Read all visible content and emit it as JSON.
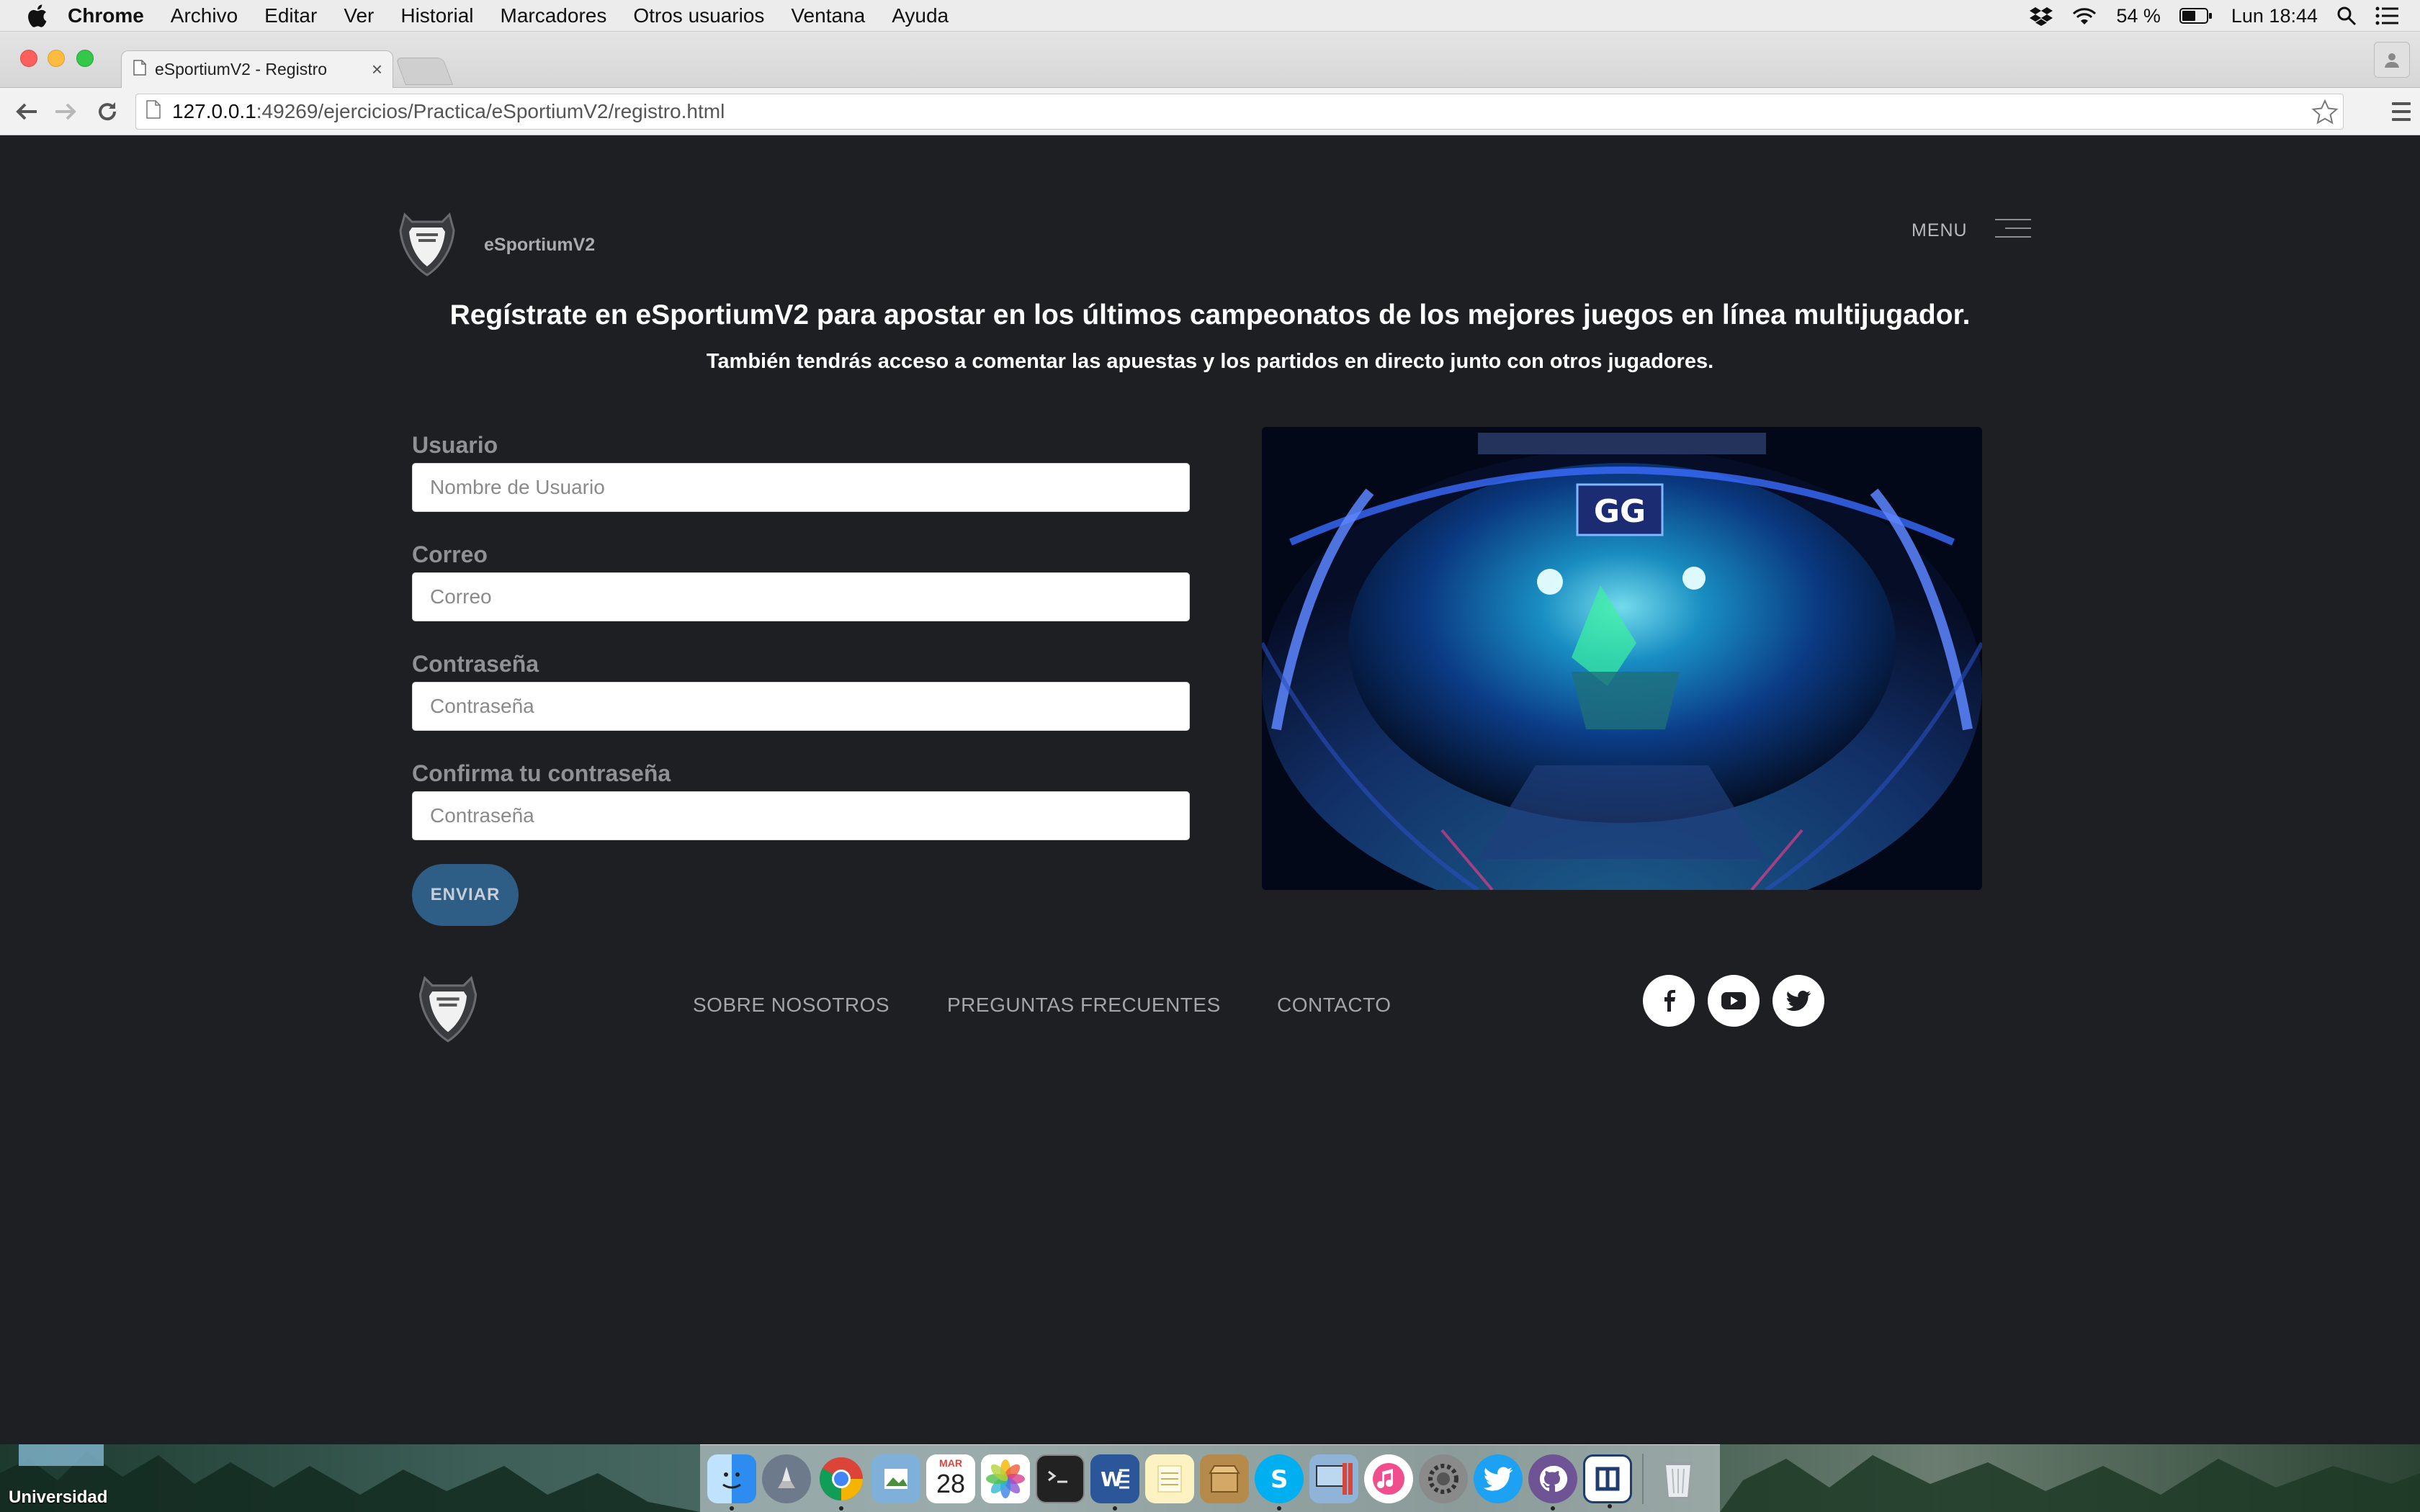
{
  "menubar": {
    "app_name": "Chrome",
    "items": [
      "Archivo",
      "Editar",
      "Ver",
      "Historial",
      "Marcadores",
      "Otros usuarios",
      "Ventana",
      "Ayuda"
    ],
    "battery": "54 %",
    "clock": "Lun 18:44",
    "icons": [
      "apple-icon",
      "dropbox-icon",
      "wifi-icon",
      "battery-icon",
      "spotlight-icon",
      "notification-center-icon"
    ]
  },
  "browser": {
    "tab_title": "eSportiumV2 - Registro",
    "tab_close": "×",
    "url_host": "127.0.0.1",
    "url_path": ":49269/ejercicios/Practica/eSportiumV2/registro.html",
    "icons": [
      "back-icon",
      "forward-icon",
      "reload-icon",
      "page-icon",
      "bookmark-star-icon",
      "chrome-menu-icon",
      "profile-icon"
    ]
  },
  "site": {
    "brand": "eSportiumV2",
    "menu_label": "MENU",
    "headline": "Regístrate en eSportiumV2 para apostar en los últimos campeonatos de los mejores juegos en línea multijugador.",
    "subheadline": "También tendrás acceso a comentar las apuestas y los partidos en directo junto con otros jugadores.",
    "form": {
      "fields": [
        {
          "label": "Usuario",
          "placeholder": "Nombre de Usuario",
          "type": "text"
        },
        {
          "label": "Correo",
          "placeholder": "Correo",
          "type": "email"
        },
        {
          "label": "Contraseña",
          "placeholder": "Contraseña",
          "type": "password"
        },
        {
          "label": "Confirma tu contraseña",
          "placeholder": "Contraseña",
          "type": "password"
        }
      ],
      "submit_label": "ENVIAR"
    },
    "image_label": "GG",
    "footer": {
      "links": [
        "SOBRE NOSOTROS",
        "PREGUNTAS FRECUENTES",
        "CONTACTO"
      ],
      "social": [
        "facebook-icon",
        "youtube-icon",
        "twitter-icon"
      ]
    },
    "colors": {
      "background": "#1d1f23",
      "button": "#2e5d86",
      "text": "#ffffff",
      "label": "#8f9194"
    }
  },
  "desktop": {
    "folder_label": "Universidad",
    "dock": [
      "finder",
      "launchpad",
      "chrome",
      "preview",
      "calendar",
      "photos",
      "terminal",
      "word",
      "notes",
      "archive-utility",
      "skype",
      "remote-desktop",
      "itunes",
      "system-preferences",
      "twitter",
      "github-desktop",
      "sourcetree",
      "trash"
    ],
    "calendar_month": "MAR",
    "calendar_day": "28"
  }
}
